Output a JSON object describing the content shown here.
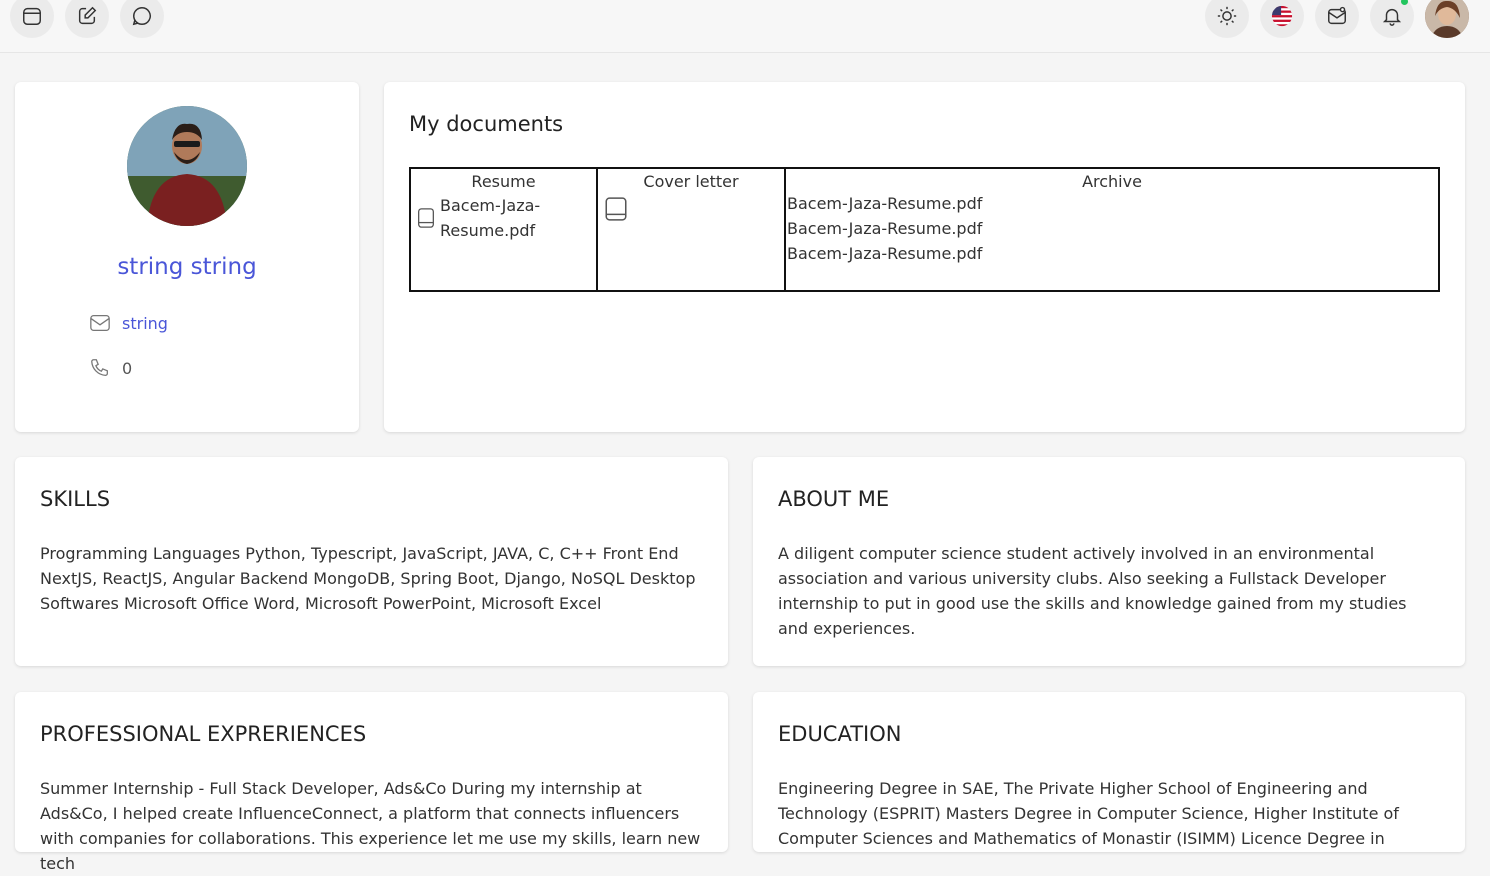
{
  "profile": {
    "name": "string string",
    "email": "string",
    "phone": "0"
  },
  "documents": {
    "title": "My documents",
    "resume_header": "Resume",
    "resume_file_line1": "Bacem-Jaza-",
    "resume_file_line2": "Resume.pdf",
    "cover_header": "Cover letter",
    "archive_header": "Archive",
    "archive_files": [
      "Bacem-Jaza-Resume.pdf",
      "Bacem-Jaza-Resume.pdf",
      "Bacem-Jaza-Resume.pdf"
    ]
  },
  "skills": {
    "title": "SKILLS",
    "text": "Programming Languages Python, Typescript, JavaScript, JAVA, C, C++ Front End NextJS, ReactJS, Angular Backend MongoDB, Spring Boot, Django, NoSQL Desktop Softwares Microsoft Office Word, Microsoft PowerPoint, Microsoft Excel"
  },
  "about": {
    "title": "ABOUT ME",
    "text": "A diligent computer science student actively involved in an environmental association and various university clubs. Also seeking a Fullstack Developer internship to put in good use the skills and knowledge gained from my studies and experiences."
  },
  "experience": {
    "title": "PROFESSIONAL EXPRERIENCES",
    "text": "Summer Internship - Full Stack Developer, Ads&Co During my internship at Ads&Co, I helped create InfluenceConnect, a platform that connects influencers with companies for collaborations. This experience let me use my skills, learn new tech"
  },
  "education": {
    "title": "EDUCATION",
    "text": "Engineering Degree in SAE, The Private Higher School of Engineering and Technology (ESPRIT) Masters Degree in Computer Science, Higher Institute of Computer Sciences and Mathematics of Monastir (ISIMM) Licence Degree in"
  },
  "topbar": {
    "icons_left": [
      "calendar-icon",
      "edit-icon",
      "chat-icon"
    ],
    "icons_right": [
      "sun-icon",
      "us-flag-icon",
      "mail-icon",
      "bell-icon",
      "user-avatar"
    ]
  },
  "colors": {
    "accent": "#4a56d8",
    "notification_dot": "#22c55e"
  }
}
